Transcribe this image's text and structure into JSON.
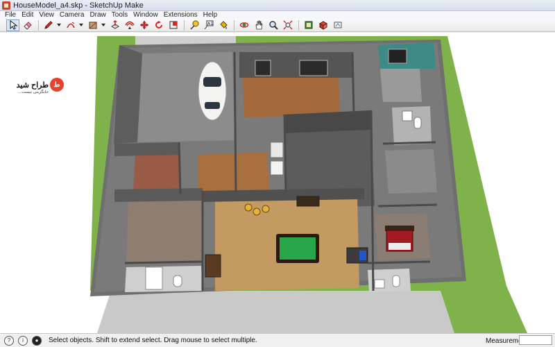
{
  "window": {
    "title": "HouseModel_a4.skp - SketchUp Make"
  },
  "menu": [
    "File",
    "Edit",
    "View",
    "Camera",
    "Draw",
    "Tools",
    "Window",
    "Extensions",
    "Help"
  ],
  "toolbar": {
    "tools": [
      {
        "name": "select-tool-button",
        "icon": "arrow-icon",
        "active": true
      },
      {
        "name": "eraser-tool-button",
        "icon": "eraser-icon"
      },
      {
        "name": "line-tool-button",
        "icon": "pencil-icon",
        "dropdown": true
      },
      {
        "name": "arc-tool-button",
        "icon": "arc-icon",
        "dropdown": true
      },
      {
        "name": "shape-tool-button",
        "icon": "rectangle-icon",
        "dropdown": true
      },
      {
        "name": "push-pull-tool-button",
        "icon": "push-pull-icon"
      },
      {
        "name": "offset-tool-button",
        "icon": "offset-icon"
      },
      {
        "name": "move-tool-button",
        "icon": "move-icon"
      },
      {
        "name": "rotate-tool-button",
        "icon": "rotate-icon"
      },
      {
        "name": "scale-tool-button",
        "icon": "scale-icon"
      },
      {
        "name": "tape-measure-tool-button",
        "icon": "tape-measure-icon"
      },
      {
        "name": "text-tool-button",
        "icon": "text-icon"
      },
      {
        "name": "paint-bucket-tool-button",
        "icon": "paint-bucket-icon"
      },
      {
        "name": "orbit-tool-button",
        "icon": "orbit-icon"
      },
      {
        "name": "pan-tool-button",
        "icon": "pan-hand-icon"
      },
      {
        "name": "zoom-tool-button",
        "icon": "magnifier-icon"
      },
      {
        "name": "zoom-extents-button",
        "icon": "zoom-extents-icon"
      },
      {
        "name": "warehouse-button",
        "icon": "warehouse-icon"
      },
      {
        "name": "extension-warehouse-button",
        "icon": "extension-icon"
      },
      {
        "name": "send-to-layout-button",
        "icon": "layout-icon"
      }
    ]
  },
  "logo": {
    "name": "طراح شید",
    "tagline": "جایگزینی نیست..."
  },
  "status": {
    "message": "Select objects. Shift to extend select. Drag mouse to select multiple.",
    "measurements_label": "Measurements",
    "measurements_value": ""
  },
  "colors": {
    "grass": "#7fb24b",
    "sidewalk": "#bdbdbd",
    "wall_top": "#6f6f6f",
    "wood_floor": "#c49a63",
    "dark_floor": "#5c5c5c",
    "brick": "#9a5a45",
    "pool_table": "#27a64a"
  }
}
